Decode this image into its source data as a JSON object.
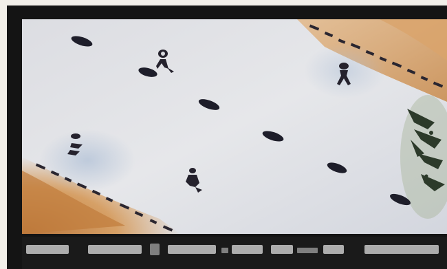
{
  "game": {
    "status_text": ""
  },
  "colors": {
    "ice": "#d8dadf",
    "ice_highlight": "#e8e9ec",
    "dirt": "#c98a4a",
    "dirt_dark": "#a8692f",
    "snow_blue": "#b9c6d6",
    "obstacle": "#1e1e2a",
    "frame": "#141414",
    "status_text": "#c9c9c9"
  },
  "sprites": {
    "obstacles": [
      "obstacle-slab",
      "obstacle-slab",
      "obstacle-slab",
      "obstacle-slab",
      "obstacle-slab",
      "obstacle-slab"
    ],
    "figures": [
      "skater-figure",
      "skater-figure",
      "skater-figure",
      "skater-figure"
    ]
  }
}
